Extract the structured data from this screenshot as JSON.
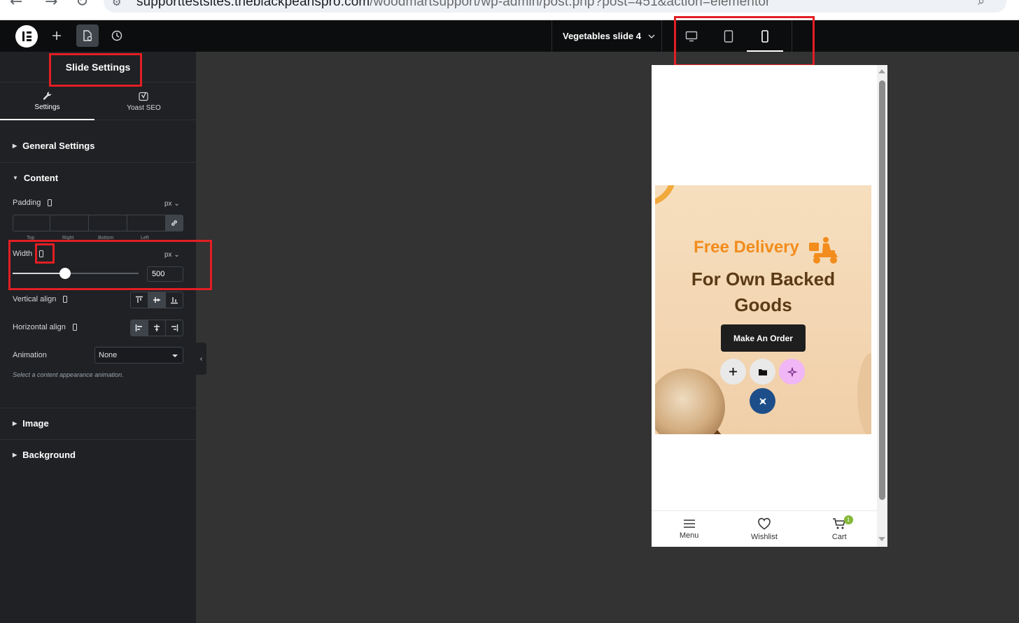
{
  "browser": {
    "url_host": "supporttestsites.theblackpearlspro.com",
    "url_path": "/woodmartsupport/wp-admin/post.php?post=451&action=elementor"
  },
  "topbar": {
    "document_title": "Vegetables slide 4",
    "devices": [
      "desktop",
      "tablet",
      "mobile"
    ],
    "active_device": "mobile"
  },
  "panel": {
    "title": "Slide Settings",
    "tabs": [
      {
        "label": "Settings",
        "icon": "wrench-icon",
        "active": true
      },
      {
        "label": "Yoast SEO",
        "icon": "yoast-icon",
        "active": false
      }
    ],
    "sections": {
      "general": "General Settings",
      "content": "Content",
      "image": "Image",
      "background": "Background"
    },
    "padding": {
      "label": "Padding",
      "unit": "px",
      "fields": [
        "Top",
        "Right",
        "Bottom",
        "Left"
      ]
    },
    "width": {
      "label": "Width",
      "unit": "px",
      "value": "500",
      "slider_fraction": 0.42
    },
    "vertical_align": {
      "label": "Vertical align",
      "options": [
        "top",
        "middle",
        "bottom"
      ],
      "active": "middle"
    },
    "horizontal_align": {
      "label": "Horizontal align",
      "options": [
        "left",
        "center",
        "right"
      ],
      "active": "left"
    },
    "animation": {
      "label": "Animation",
      "value": "None",
      "hint": "Select a content appearance animation."
    }
  },
  "preview": {
    "line1": "Free Delivery",
    "line2": "For Own Backed",
    "line3": "Goods",
    "cta": "Make An Order",
    "editor_buttons": [
      "plus-icon",
      "folder-icon",
      "sparkle-icon",
      "elementor-kit-icon"
    ],
    "bottom_nav": [
      {
        "label": "Menu",
        "icon": "menu-icon"
      },
      {
        "label": "Wishlist",
        "icon": "heart-icon"
      },
      {
        "label": "Cart",
        "icon": "cart-icon",
        "badge": "1"
      }
    ]
  },
  "colors": {
    "accent_orange": "#f28c1c",
    "heading_brown": "#5b3a16",
    "annotation_red": "#e31e24",
    "badge_green": "#83b735"
  }
}
